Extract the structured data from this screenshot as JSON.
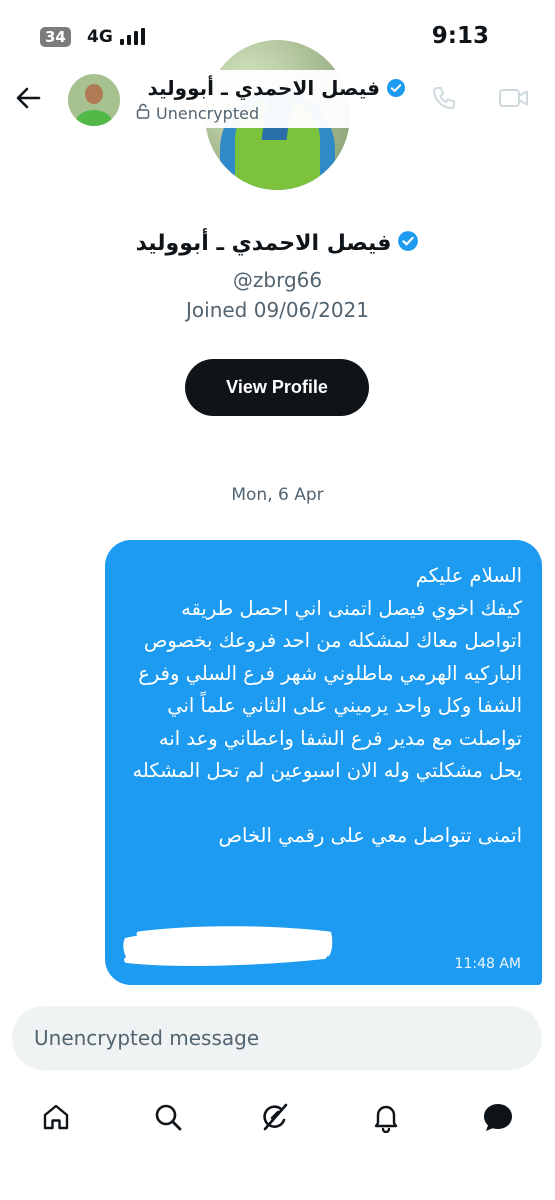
{
  "status_bar": {
    "battery": "34",
    "network": "4G",
    "time": "9:13"
  },
  "header": {
    "name": "فيصل الاحمدي ـ أبووليد",
    "encryption_status": "Unencrypted"
  },
  "profile": {
    "name": "فيصل الاحمدي ـ أبووليد",
    "handle": "@zbrg66",
    "joined": "Joined 09/06/2021",
    "view_profile_label": "View Profile"
  },
  "conversation": {
    "date": "Mon, 6 Apr",
    "message": {
      "text": "السلام عليكم\nكيفك اخوي فيصل اتمنى اني احصل طريقه اتواصل معاك لمشكله من احد فروعك بخصوص الباركيه الهرمي ماطلوني شهر فرع السلي وفرع الشفا وكل واحد يرميني على الثاني علماً اني تواصلت مع مدير فرع الشفا واعطاني وعد انه يحل مشكلتي وله الان اسبوعين لم تحل المشكله\n\nاتمنى تتواصل معي على رقمي الخاص",
      "time": "11:48 AM"
    }
  },
  "composer": {
    "placeholder": "Unencrypted message"
  },
  "colors": {
    "accent": "#1d9bf0",
    "text_primary": "#0f1419",
    "text_secondary": "#536471",
    "composer_bg": "#eff3f4"
  },
  "icons": {
    "back": "arrow-left-icon",
    "verified": "verified-badge-icon",
    "lock": "lock-open-icon",
    "call": "phone-icon",
    "video": "video-camera-icon",
    "nav": [
      "home-icon",
      "search-icon",
      "grok-icon",
      "bell-icon",
      "messages-icon"
    ]
  }
}
